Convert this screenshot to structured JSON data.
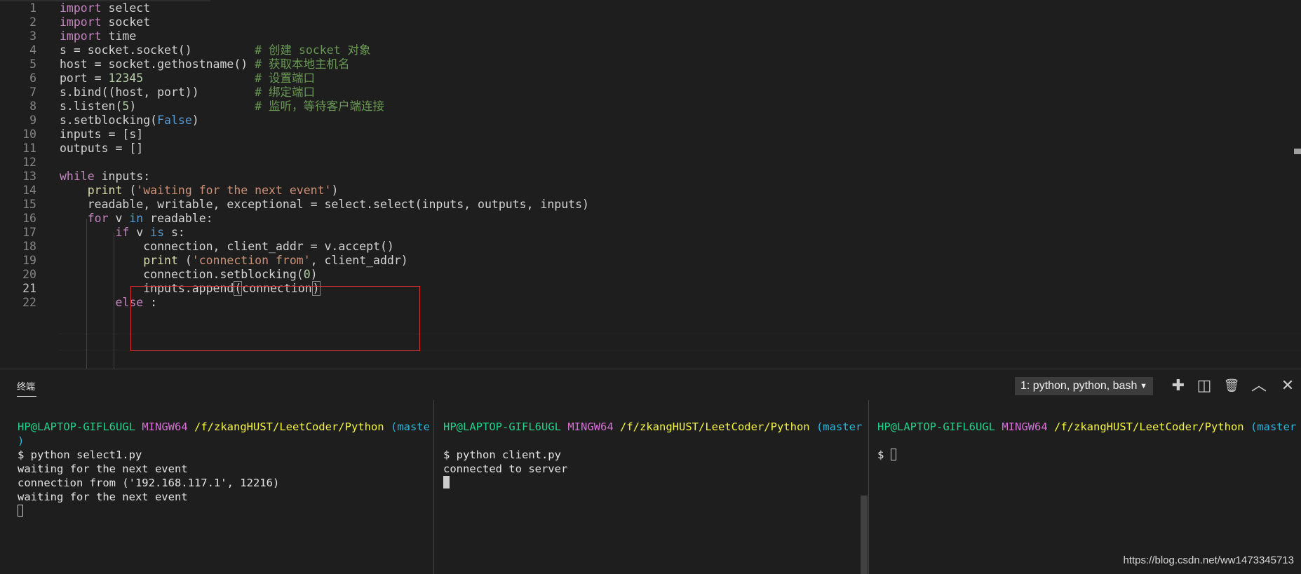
{
  "editor": {
    "lines": [
      {
        "n": "1",
        "tokens": [
          [
            "kw",
            "import"
          ],
          [
            "tx",
            " select"
          ]
        ]
      },
      {
        "n": "2",
        "tokens": [
          [
            "kw",
            "import"
          ],
          [
            "tx",
            " socket"
          ]
        ]
      },
      {
        "n": "3",
        "tokens": [
          [
            "kw",
            "import"
          ],
          [
            "tx",
            " time"
          ]
        ]
      },
      {
        "n": "4",
        "tokens": [
          [
            "tx",
            "s = socket.socket()         "
          ],
          [
            "cm",
            "# 创建 socket 对象"
          ]
        ]
      },
      {
        "n": "5",
        "tokens": [
          [
            "tx",
            "host = socket.gethostname() "
          ],
          [
            "cm",
            "# 获取本地主机名"
          ]
        ]
      },
      {
        "n": "6",
        "tokens": [
          [
            "tx",
            "port = "
          ],
          [
            "num",
            "12345"
          ],
          [
            "tx",
            "                "
          ],
          [
            "cm",
            "# 设置端口"
          ]
        ]
      },
      {
        "n": "7",
        "tokens": [
          [
            "tx",
            "s.bind((host, port))        "
          ],
          [
            "cm",
            "# 绑定端口"
          ]
        ]
      },
      {
        "n": "8",
        "tokens": [
          [
            "tx",
            "s.listen("
          ],
          [
            "num",
            "5"
          ],
          [
            "tx",
            ")                 "
          ],
          [
            "cm",
            "# 监听，等待客户端连接"
          ]
        ]
      },
      {
        "n": "9",
        "tokens": [
          [
            "tx",
            "s.setblocking("
          ],
          [
            "bl",
            "False"
          ],
          [
            "tx",
            ")"
          ]
        ]
      },
      {
        "n": "10",
        "tokens": [
          [
            "tx",
            "inputs = [s]"
          ]
        ]
      },
      {
        "n": "11",
        "tokens": [
          [
            "tx",
            "outputs = []"
          ]
        ]
      },
      {
        "n": "12",
        "tokens": []
      },
      {
        "n": "13",
        "tokens": [
          [
            "kw",
            "while"
          ],
          [
            "tx",
            " inputs:"
          ]
        ]
      },
      {
        "n": "14",
        "tokens": [
          [
            "tx",
            "    "
          ],
          [
            "fn",
            "print"
          ],
          [
            "tx",
            " ("
          ],
          [
            "str",
            "'waiting for the next event'"
          ],
          [
            "tx",
            ")"
          ]
        ]
      },
      {
        "n": "15",
        "tokens": [
          [
            "tx",
            "    readable, writable, exceptional = select.select(inputs, outputs, inputs)"
          ]
        ]
      },
      {
        "n": "16",
        "tokens": [
          [
            "tx",
            "    "
          ],
          [
            "kw",
            "for"
          ],
          [
            "tx",
            " v "
          ],
          [
            "bl",
            "in"
          ],
          [
            "tx",
            " readable:"
          ]
        ]
      },
      {
        "n": "17",
        "tokens": [
          [
            "tx",
            "        "
          ],
          [
            "kw",
            "if"
          ],
          [
            "tx",
            " v "
          ],
          [
            "bl",
            "is"
          ],
          [
            "tx",
            " s:"
          ]
        ]
      },
      {
        "n": "18",
        "tokens": [
          [
            "tx",
            "            connection, client_addr = v.accept()"
          ]
        ]
      },
      {
        "n": "19",
        "tokens": [
          [
            "tx",
            "            "
          ],
          [
            "fn",
            "print"
          ],
          [
            "tx",
            " ("
          ],
          [
            "str",
            "'connection from'"
          ],
          [
            "tx",
            ", client_addr)"
          ]
        ]
      },
      {
        "n": "20",
        "tokens": [
          [
            "tx",
            "            connection.setblocking("
          ],
          [
            "num",
            "0"
          ],
          [
            "tx",
            ")"
          ]
        ]
      },
      {
        "n": "21",
        "tokens": [
          [
            "tx",
            "            inputs.append"
          ],
          [
            "bx",
            "("
          ],
          [
            "tx",
            "connection"
          ],
          [
            "bx",
            ")"
          ]
        ]
      },
      {
        "n": "22",
        "tokens": [
          [
            "tx",
            "        "
          ],
          [
            "kw",
            "else"
          ],
          [
            "tx",
            " :"
          ]
        ]
      }
    ],
    "current_line": "21"
  },
  "panel": {
    "title": "终端",
    "terminal_select": "1: python, python, bash",
    "tools": [
      {
        "name": "new-terminal-icon",
        "glyph": "✚"
      },
      {
        "name": "split-terminal-icon",
        "glyph": "◫"
      },
      {
        "name": "trash-icon",
        "glyph": "🗑"
      },
      {
        "name": "maximize-panel-icon",
        "glyph": "︿"
      },
      {
        "name": "close-panel-icon",
        "glyph": "✕"
      }
    ]
  },
  "terminals": [
    {
      "prompt": {
        "user": "HP@LAPTOP-GIFL6UGL",
        "env": "MINGW64",
        "path": "/f/zkangHUST/LeetCoder/Python",
        "branch": "(master"
      },
      "lines": [
        ")",
        "$ python select1.py",
        "waiting for the next event",
        "connection from ('192.168.117.1', 12216)",
        "waiting for the next event"
      ],
      "cursor": "hollow"
    },
    {
      "prompt": {
        "user": "HP@LAPTOP-GIFL6UGL",
        "env": "MINGW64",
        "path": "/f/zkangHUST/LeetCoder/Python",
        "branch": "(master)"
      },
      "lines": [
        "",
        "$ python client.py",
        "connected to server"
      ],
      "cursor": "block"
    },
    {
      "prompt": {
        "user": "HP@LAPTOP-GIFL6UGL",
        "env": "MINGW64",
        "path": "/f/zkangHUST/LeetCoder/Python",
        "branch": "(master)"
      },
      "lines": [
        "",
        "$ "
      ],
      "cursor": "hollow-inline"
    }
  ],
  "watermark": "https://blog.csdn.net/ww1473345713",
  "colors": {
    "background": "#1e1e1e",
    "keyword": "#c586c0",
    "builtin": "#569cd6",
    "string": "#ce9178",
    "comment": "#6a9955",
    "selection_box": "#e03030",
    "prompt_user": "#23d18b",
    "prompt_env": "#d670d6",
    "prompt_path": "#f5f543",
    "prompt_branch": "#29b8db"
  }
}
